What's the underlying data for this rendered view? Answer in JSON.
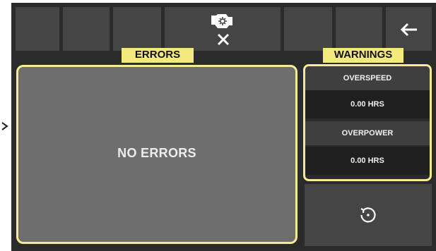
{
  "header": {
    "top_icon": "engine-warning-icon",
    "clear_icon": "close-icon",
    "back_icon": "back-arrow-icon"
  },
  "errors": {
    "title": "ERRORS",
    "message": "NO ERRORS"
  },
  "warnings": {
    "title": "WARNINGS",
    "items": [
      {
        "label": "OVERSPEED",
        "value": "0.00 HRS"
      },
      {
        "label": "OVERPOWER",
        "value": "0.00 HRS"
      }
    ]
  },
  "reset": {
    "icon": "reset-icon"
  },
  "colors": {
    "highlight": "#f3ea7d",
    "panel": "#6e6e6e",
    "background": "#2b2b2b",
    "button": "#454545"
  }
}
